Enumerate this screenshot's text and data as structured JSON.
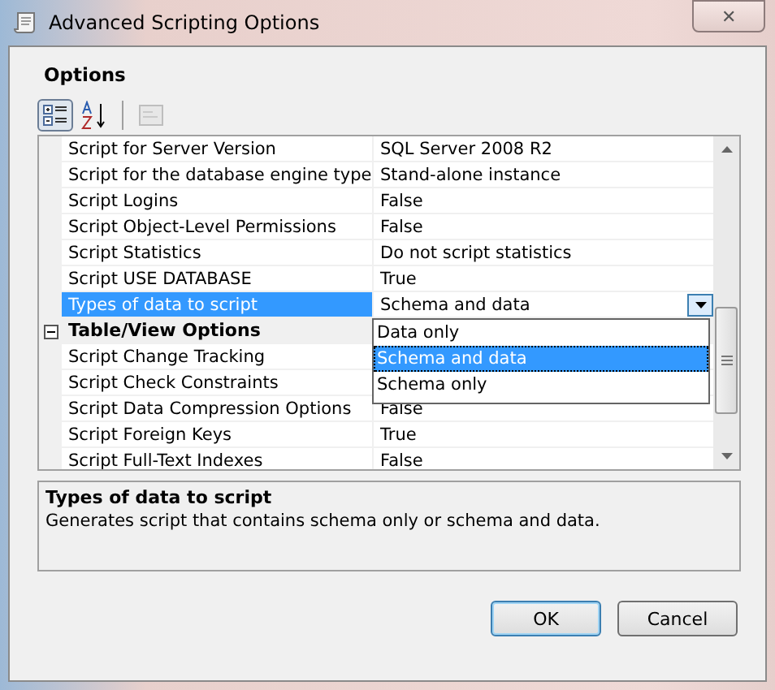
{
  "window": {
    "title": "Advanced Scripting Options",
    "close": "✕"
  },
  "section_title": "Options",
  "toolbar": [
    {
      "kind": "categorized",
      "selected": true
    },
    {
      "kind": "alphabetical",
      "selected": false
    },
    {
      "kind": "pages",
      "disabled": true
    }
  ],
  "grid": {
    "rows": [
      {
        "kind": "property",
        "name": "Script for Server Version",
        "value": "SQL Server 2008 R2",
        "selected": false
      },
      {
        "kind": "property",
        "name": "Script for the database engine type",
        "value": "Stand-alone instance",
        "selected": false
      },
      {
        "kind": "property",
        "name": "Script Logins",
        "value": "False",
        "selected": false
      },
      {
        "kind": "property",
        "name": "Script Object-Level Permissions",
        "value": "False",
        "selected": false
      },
      {
        "kind": "property",
        "name": "Script Statistics",
        "value": "Do not script statistics",
        "selected": false
      },
      {
        "kind": "property",
        "name": "Script USE DATABASE",
        "value": "True",
        "selected": false
      },
      {
        "kind": "property",
        "name": "Types of data to script",
        "value": "Schema and data",
        "selected": true
      },
      {
        "kind": "category",
        "name": "Table/View Options",
        "expanded": true
      },
      {
        "kind": "property",
        "name": "Script Change Tracking",
        "selected": false
      },
      {
        "kind": "property",
        "name": "Script Check Constraints",
        "selected": false
      },
      {
        "kind": "property",
        "name": "Script Data Compression Options",
        "value": "False",
        "selected": false
      },
      {
        "kind": "property",
        "name": "Script Foreign Keys",
        "value": "True",
        "selected": false
      },
      {
        "kind": "property",
        "name": "Script Full-Text Indexes",
        "value": "False",
        "selected": false
      }
    ],
    "dropdown": [
      {
        "label": "Data only",
        "selected": false
      },
      {
        "label": "Schema and data",
        "selected": true
      },
      {
        "label": "Schema only",
        "selected": false
      }
    ]
  },
  "description": {
    "title": "Types of data to script",
    "text": "Generates script that contains schema only or schema and data."
  },
  "buttons": [
    {
      "label": "OK",
      "default": true
    },
    {
      "label": "Cancel",
      "default": false
    }
  ]
}
